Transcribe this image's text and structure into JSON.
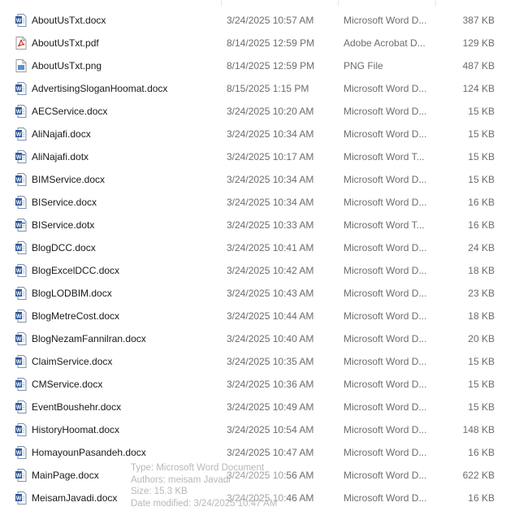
{
  "files": [
    {
      "name": "AboutUsTxt.docx",
      "date": "3/24/2025 10:57 AM",
      "type": "Microsoft Word D...",
      "size": "387 KB",
      "icon": "word-doc-icon"
    },
    {
      "name": "AboutUsTxt.pdf",
      "date": "8/14/2025 12:59 PM",
      "type": "Adobe Acrobat D...",
      "size": "129 KB",
      "icon": "pdf-file-icon"
    },
    {
      "name": "AboutUsTxt.png",
      "date": "8/14/2025 12:59 PM",
      "type": "PNG File",
      "size": "487 KB",
      "icon": "png-file-icon"
    },
    {
      "name": "AdvertisingSloganHoomat.docx",
      "date": "8/15/2025 1:15 PM",
      "type": "Microsoft Word D...",
      "size": "124 KB",
      "icon": "word-doc-icon"
    },
    {
      "name": "AECService.docx",
      "date": "3/24/2025 10:20 AM",
      "type": "Microsoft Word D...",
      "size": "15 KB",
      "icon": "word-doc-icon"
    },
    {
      "name": "AliNajafi.docx",
      "date": "3/24/2025 10:34 AM",
      "type": "Microsoft Word D...",
      "size": "15 KB",
      "icon": "word-doc-icon"
    },
    {
      "name": "AliNajafi.dotx",
      "date": "3/24/2025 10:17 AM",
      "type": "Microsoft Word T...",
      "size": "15 KB",
      "icon": "word-template-icon"
    },
    {
      "name": "BIMService.docx",
      "date": "3/24/2025 10:34 AM",
      "type": "Microsoft Word D...",
      "size": "15 KB",
      "icon": "word-doc-icon"
    },
    {
      "name": "BIService.docx",
      "date": "3/24/2025 10:34 AM",
      "type": "Microsoft Word D...",
      "size": "16 KB",
      "icon": "word-doc-icon"
    },
    {
      "name": "BIService.dotx",
      "date": "3/24/2025 10:33 AM",
      "type": "Microsoft Word T...",
      "size": "16 KB",
      "icon": "word-template-icon"
    },
    {
      "name": "BlogDCC.docx",
      "date": "3/24/2025 10:41 AM",
      "type": "Microsoft Word D...",
      "size": "24 KB",
      "icon": "word-doc-icon"
    },
    {
      "name": "BlogExcelDCC.docx",
      "date": "3/24/2025 10:42 AM",
      "type": "Microsoft Word D...",
      "size": "18 KB",
      "icon": "word-doc-icon"
    },
    {
      "name": "BlogLODBIM.docx",
      "date": "3/24/2025 10:43 AM",
      "type": "Microsoft Word D...",
      "size": "23 KB",
      "icon": "word-doc-icon"
    },
    {
      "name": "BlogMetreCost.docx",
      "date": "3/24/2025 10:44 AM",
      "type": "Microsoft Word D...",
      "size": "18 KB",
      "icon": "word-doc-icon"
    },
    {
      "name": "BlogNezamFannilran.docx",
      "date": "3/24/2025 10:40 AM",
      "type": "Microsoft Word D...",
      "size": "20 KB",
      "icon": "word-doc-icon"
    },
    {
      "name": "ClaimService.docx",
      "date": "3/24/2025 10:35 AM",
      "type": "Microsoft Word D...",
      "size": "15 KB",
      "icon": "word-doc-icon"
    },
    {
      "name": "CMService.docx",
      "date": "3/24/2025 10:36 AM",
      "type": "Microsoft Word D...",
      "size": "15 KB",
      "icon": "word-doc-icon"
    },
    {
      "name": "EventBoushehr.docx",
      "date": "3/24/2025 10:49 AM",
      "type": "Microsoft Word D...",
      "size": "15 KB",
      "icon": "word-doc-icon"
    },
    {
      "name": "HistoryHoomat.docx",
      "date": "3/24/2025 10:54 AM",
      "type": "Microsoft Word D...",
      "size": "148 KB",
      "icon": "word-doc-icon"
    },
    {
      "name": "HomayounPasandeh.docx",
      "date": "3/24/2025 10:47 AM",
      "type": "Microsoft Word D...",
      "size": "16 KB",
      "icon": "word-doc-icon"
    },
    {
      "name": "MainPage.docx",
      "date": "3/24/2025 10:56 AM",
      "type": "Microsoft Word D...",
      "size": "622 KB",
      "icon": "word-doc-icon"
    },
    {
      "name": "MeisamJavadi.docx",
      "date": "3/24/2025 10:46 AM",
      "type": "Microsoft Word D...",
      "size": "16 KB",
      "icon": "word-doc-icon"
    }
  ],
  "tooltip": {
    "type": "Type: Microsoft Word Document",
    "authors": "Authors: meisam Javadi",
    "size": "Size: 15.3 KB",
    "modified": "Date modified: 3/24/2025 10:47 AM"
  },
  "colors": {
    "word_blue": "#2b579a",
    "pdf_red": "#d0312d",
    "muted_text": "#6d6d6d"
  }
}
